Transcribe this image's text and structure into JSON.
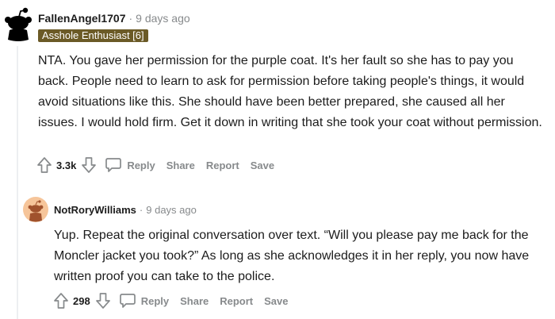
{
  "comments": [
    {
      "username": "FallenAngel1707",
      "separator": "·",
      "age": "9 days ago",
      "flair": "Asshole Enthusiast [6]",
      "body": "NTA. You gave her permission for the purple coat. It's her fault so she has to pay you back. People need to learn to ask for permission before taking people's things, it would avoid situations like this. She should have been better prepared, she caused all her issues. I would hold firm. Get it down in writing that she took your coat without permission.",
      "score": "3.3k",
      "actions": {
        "reply": "Reply",
        "share": "Share",
        "report": "Report",
        "save": "Save"
      },
      "avatar_icon": "snoo-silhouette-icon"
    },
    {
      "username": "NotRoryWilliams",
      "separator": "·",
      "age": "9 days ago",
      "body": "Yup. Repeat the original conversation over text. “Will you please pay me back for the Moncler jacket you took?” As long as she acknowledges it in her reply, you now have written proof you can take to the police.",
      "score": "298",
      "actions": {
        "reply": "Reply",
        "share": "Share",
        "report": "Report",
        "save": "Save"
      },
      "avatar_icon": "snoo-avatar-icon"
    }
  ],
  "colors": {
    "flair_bg": "#6b5a26",
    "meta_gray": "#878a8c",
    "text": "#1c1c1c",
    "avatar_orange": "#f6c59a"
  }
}
